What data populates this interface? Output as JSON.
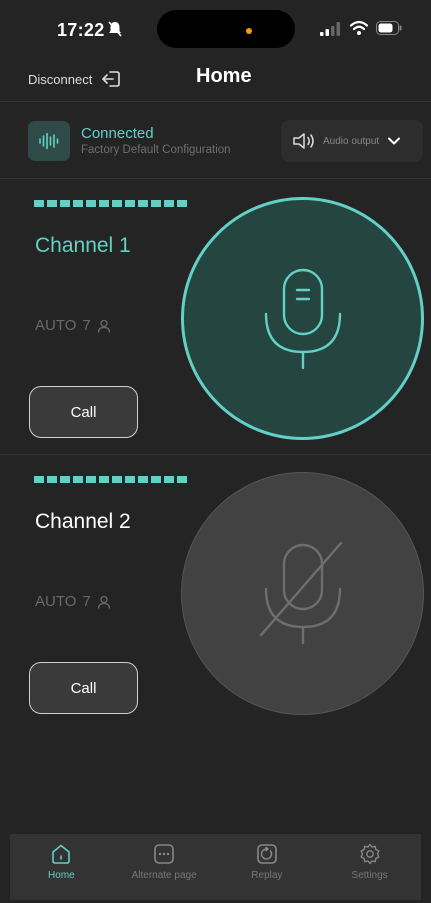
{
  "status_bar": {
    "time": "17:22"
  },
  "header": {
    "disconnect_label": "Disconnect",
    "title": "Home"
  },
  "connection": {
    "status": "Connected",
    "configuration": "Factory Default Configuration",
    "audio_output_label": "Audio output"
  },
  "channels": [
    {
      "name": "Channel 1",
      "mode": "AUTO",
      "count": "7",
      "call_label": "Call",
      "active": true
    },
    {
      "name": "Channel 2",
      "mode": "AUTO",
      "count": "7",
      "call_label": "Call",
      "active": false
    }
  ],
  "nav": {
    "items": [
      {
        "label": "Home",
        "icon": "home-icon"
      },
      {
        "label": "Alternate page",
        "icon": "alternate-page-icon"
      },
      {
        "label": "Replay",
        "icon": "replay-icon"
      },
      {
        "label": "Settings",
        "icon": "gear-icon"
      }
    ],
    "active": "Home"
  },
  "colors": {
    "accent": "#63d0c6",
    "background": "#242424"
  }
}
